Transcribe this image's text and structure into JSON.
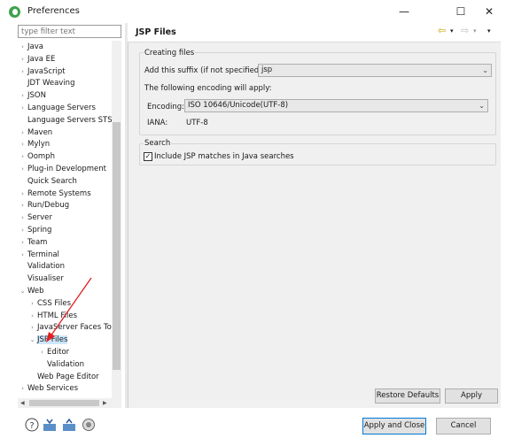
{
  "window": {
    "title": "Preferences",
    "minimize": "—",
    "maximize": "☐",
    "close": "✕"
  },
  "filter": {
    "placeholder": "type filter text"
  },
  "tree": [
    {
      "label": "Java",
      "twisty": "›",
      "indent": 0
    },
    {
      "label": "Java EE",
      "twisty": "›",
      "indent": 0
    },
    {
      "label": "JavaScript",
      "twisty": "›",
      "indent": 0
    },
    {
      "label": "JDT Weaving",
      "twisty": "",
      "indent": 0
    },
    {
      "label": "JSON",
      "twisty": "›",
      "indent": 0
    },
    {
      "label": "Language Servers",
      "twisty": "›",
      "indent": 0
    },
    {
      "label": "Language Servers STS",
      "twisty": "",
      "indent": 0
    },
    {
      "label": "Maven",
      "twisty": "›",
      "indent": 0
    },
    {
      "label": "Mylyn",
      "twisty": "›",
      "indent": 0
    },
    {
      "label": "Oomph",
      "twisty": "›",
      "indent": 0
    },
    {
      "label": "Plug-in Development",
      "twisty": "›",
      "indent": 0
    },
    {
      "label": "Quick Search",
      "twisty": "",
      "indent": 0
    },
    {
      "label": "Remote Systems",
      "twisty": "›",
      "indent": 0
    },
    {
      "label": "Run/Debug",
      "twisty": "›",
      "indent": 0
    },
    {
      "label": "Server",
      "twisty": "›",
      "indent": 0
    },
    {
      "label": "Spring",
      "twisty": "›",
      "indent": 0
    },
    {
      "label": "Team",
      "twisty": "›",
      "indent": 0
    },
    {
      "label": "Terminal",
      "twisty": "›",
      "indent": 0
    },
    {
      "label": "Validation",
      "twisty": "",
      "indent": 0
    },
    {
      "label": "Visualiser",
      "twisty": "",
      "indent": 0
    },
    {
      "label": "Web",
      "twisty": "⌄",
      "indent": 0
    },
    {
      "label": "CSS Files",
      "twisty": "›",
      "indent": 1
    },
    {
      "label": "HTML Files",
      "twisty": "›",
      "indent": 1
    },
    {
      "label": "JavaServer Faces Tools",
      "twisty": "›",
      "indent": 1
    },
    {
      "label": "JSP Files",
      "twisty": "⌄",
      "indent": 1,
      "selected": true
    },
    {
      "label": "Editor",
      "twisty": "›",
      "indent": 2
    },
    {
      "label": "Validation",
      "twisty": "",
      "indent": 2
    },
    {
      "label": "Web Page Editor",
      "twisty": "",
      "indent": 1
    },
    {
      "label": "Web Services",
      "twisty": "›",
      "indent": 0
    }
  ],
  "panel": {
    "title": "JSP Files",
    "creating": {
      "legend": "Creating files",
      "suffix_label": "Add this suffix (if not specified):",
      "suffix_value": "jsp",
      "encoding_note": "The following encoding will apply:",
      "encoding_label": "Encoding:",
      "encoding_value": "ISO 10646/Unicode(UTF-8)",
      "iana_label": "IANA:",
      "iana_value": "UTF-8"
    },
    "search": {
      "legend": "Search",
      "checkbox_label": "Include JSP matches in Java searches",
      "checked": true
    },
    "restore_defaults": "Restore Defaults",
    "apply": "Apply"
  },
  "footer": {
    "apply_close": "Apply and Close",
    "cancel": "Cancel"
  },
  "colors": {
    "selection": "#cde8ff",
    "panel_bg": "#f0f0f0",
    "accent": "#0078d7",
    "annotation": "#e02020"
  }
}
